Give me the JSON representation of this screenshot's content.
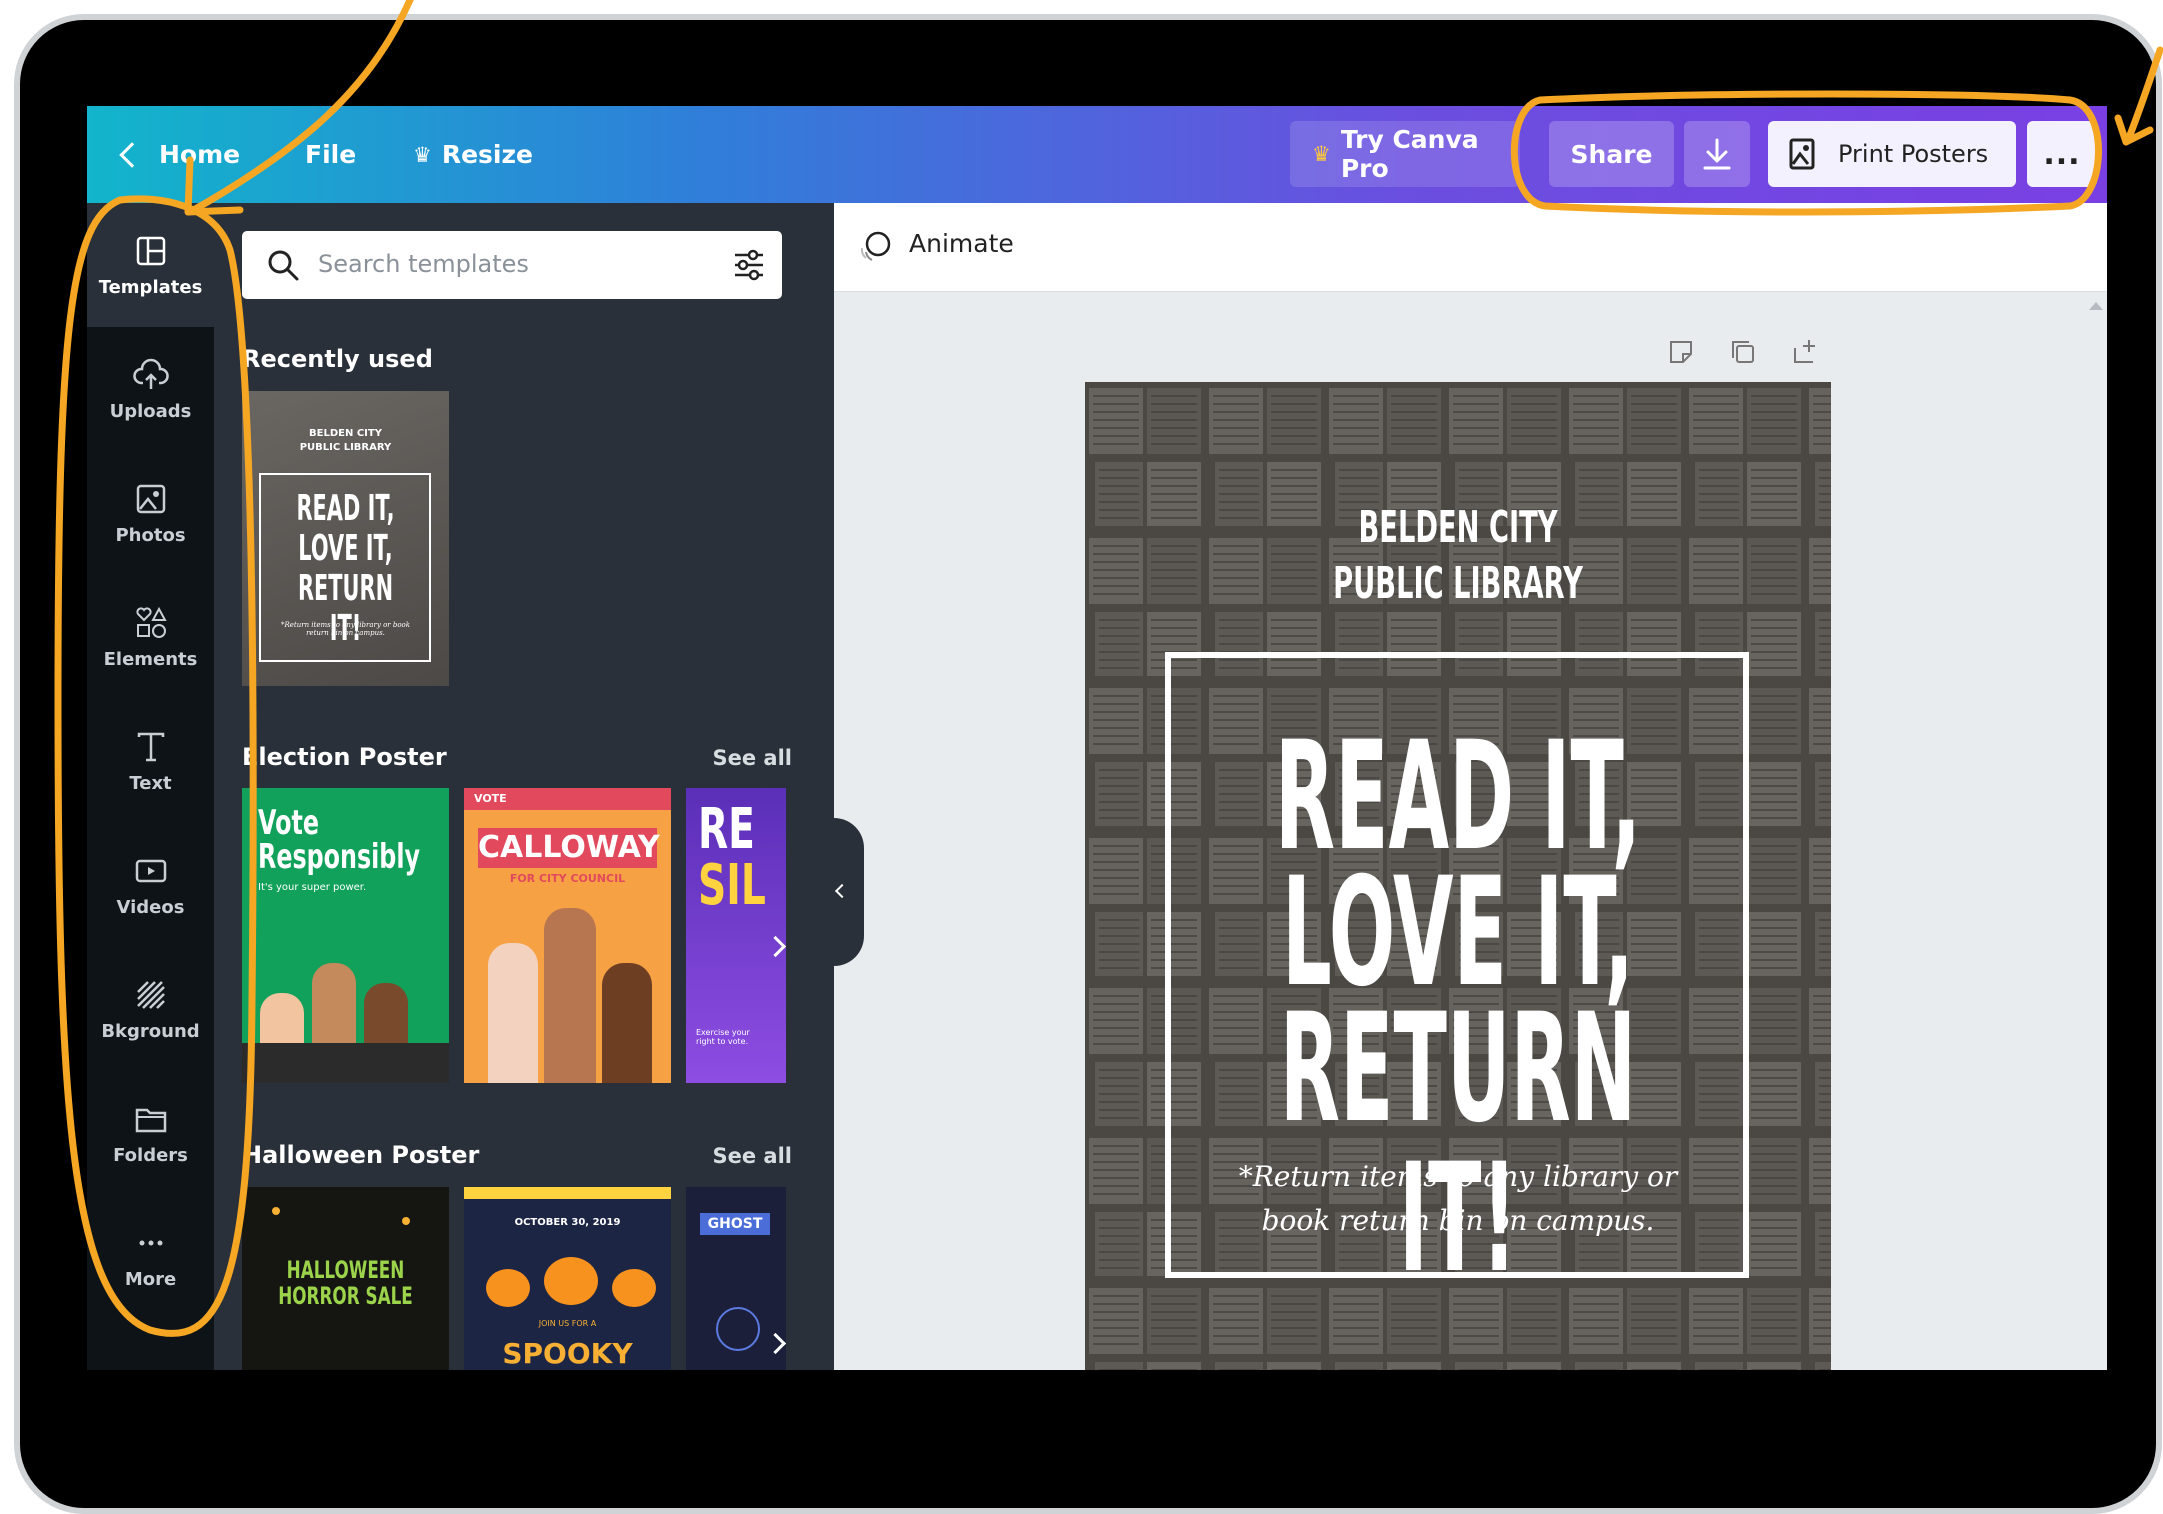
{
  "topbar": {
    "home_label": "Home",
    "file_label": "File",
    "resize_label": "Resize",
    "try_pro_label": "Try Canva Pro",
    "share_label": "Share",
    "print_label": "Print Posters",
    "more_label": "..."
  },
  "rail": {
    "items": [
      {
        "label": "Templates",
        "icon": "templates-icon"
      },
      {
        "label": "Uploads",
        "icon": "upload-cloud-icon"
      },
      {
        "label": "Photos",
        "icon": "photo-icon"
      },
      {
        "label": "Elements",
        "icon": "shapes-icon"
      },
      {
        "label": "Text",
        "icon": "text-icon"
      },
      {
        "label": "Videos",
        "icon": "video-icon"
      },
      {
        "label": "Bkground",
        "icon": "background-pattern-icon"
      },
      {
        "label": "Folders",
        "icon": "folder-icon"
      },
      {
        "label": "More",
        "icon": "ellipsis-icon"
      }
    ]
  },
  "panel": {
    "search_placeholder": "Search templates",
    "recent_title": "Recently used",
    "recent_thumb": {
      "line1": "BELDEN CITY",
      "line2": "PUBLIC LIBRARY",
      "headline": [
        "READ IT,",
        "LOVE IT,",
        "RETURN IT!"
      ],
      "note": "*Return items to any library or book return bin on campus."
    },
    "sections": [
      {
        "title": "Election Poster",
        "see_all": "See all",
        "thumbs": [
          {
            "text1": "Vote",
            "text2": "Responsibly",
            "text3": "It's your super power."
          },
          {
            "text1": "VOTE",
            "text2": "CALLOWAY",
            "text3": "FOR CITY COUNCIL"
          },
          {
            "text1": "RE",
            "text2": "SIL",
            "text3": "Exercise your right to vote."
          }
        ]
      },
      {
        "title": "Halloween Poster",
        "see_all": "See all",
        "thumbs": [
          {
            "text1": "HALLOWEEN",
            "text2": "HORROR SALE"
          },
          {
            "text1": "OCTOBER 30, 2019",
            "text2": "SPOOKY",
            "text3": "JOIN US FOR A"
          },
          {
            "text1": "GHOST"
          }
        ]
      }
    ]
  },
  "editor": {
    "animate_label": "Animate",
    "poster": {
      "line1": "BELDEN CITY",
      "line2": "PUBLIC LIBRARY",
      "headline": [
        "READ IT,",
        "LOVE IT,",
        "RETURN IT!"
      ],
      "note_line1": "*Return items to any library or",
      "note_line2": "book return bin on campus."
    }
  },
  "colors": {
    "annotation": "#f5a623",
    "topbar_start": "#12b5cb",
    "topbar_end": "#7a3fe3",
    "panel_bg": "#293039",
    "rail_bg": "#0e1318"
  }
}
